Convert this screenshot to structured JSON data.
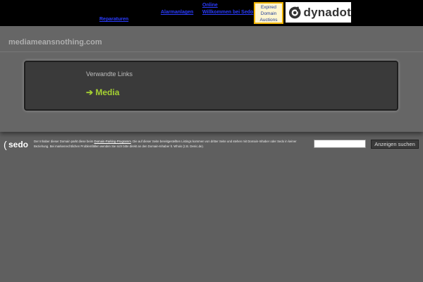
{
  "top_links": {
    "link_1": "Reparaturen",
    "link_2": "Alarmanlagen",
    "link_3": "Online",
    "link_4": "Willkommen bei Sedo"
  },
  "expired_ad": {
    "line_1": "Expired",
    "line_2": "Domain",
    "line_3": "Auctions"
  },
  "dynadot_ad": {
    "logo_text": "dynadot",
    "icon": "dynadot-logo-icon"
  },
  "header": {
    "site_title": "mediameansnothing.com"
  },
  "related_links": {
    "title": "Verwandte Links",
    "items": [
      {
        "label": "➔ Media"
      }
    ]
  },
  "footer": {
    "logo_text": "sedo",
    "text_1": "Der Inhaber dieser Domain parkt diese beim ",
    "program_link": "Domain-Parking-Programm",
    "text_2": ". Die auf dieser Seite bereitgestellten Listings kommen von dritter Seite und stehen mit Domain-Inhaber oder Sedo in keiner Beziehung. Bei markenrechtlichen Problemfällen wenden Sie sich bitte direkt an den Domain-Inhaber lt. Whois (z.B. Denic.de).",
    "search_button": "Anzeigen suchen"
  },
  "colors": {
    "accent_green": "#a5d032",
    "page_bg": "#5f5f5f",
    "panel_bg": "#3a3a3a"
  }
}
